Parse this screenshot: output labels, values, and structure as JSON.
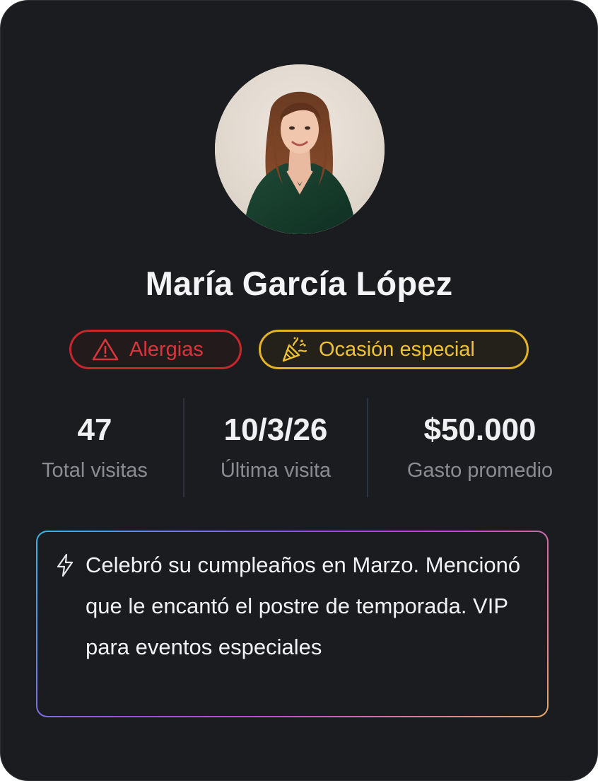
{
  "customer": {
    "name": "María García López",
    "avatar_alt": "customer-portrait"
  },
  "badges": [
    {
      "label": "Alergias",
      "icon": "warning-triangle-icon",
      "color": "#c8262d"
    },
    {
      "label": "Ocasión especial",
      "icon": "party-popper-icon",
      "color": "#e3b225"
    }
  ],
  "stats": [
    {
      "value": "47",
      "label": "Total visitas"
    },
    {
      "value": "10/3/26",
      "label": "Última visita"
    },
    {
      "value": "$50.000",
      "label": "Gasto promedio"
    }
  ],
  "note": {
    "icon": "lightning-bolt-icon",
    "text": "Celebró su cumpleaños en Marzo. Mencionó que le encantó el postre de temporada. VIP para eventos especiales"
  },
  "colors": {
    "card_bg": "#1b1c1f",
    "stat_label": "#8a8c92",
    "gradient": [
      "#38b6e0",
      "#9c4ae0",
      "#c04ad0",
      "#e8a868"
    ]
  }
}
